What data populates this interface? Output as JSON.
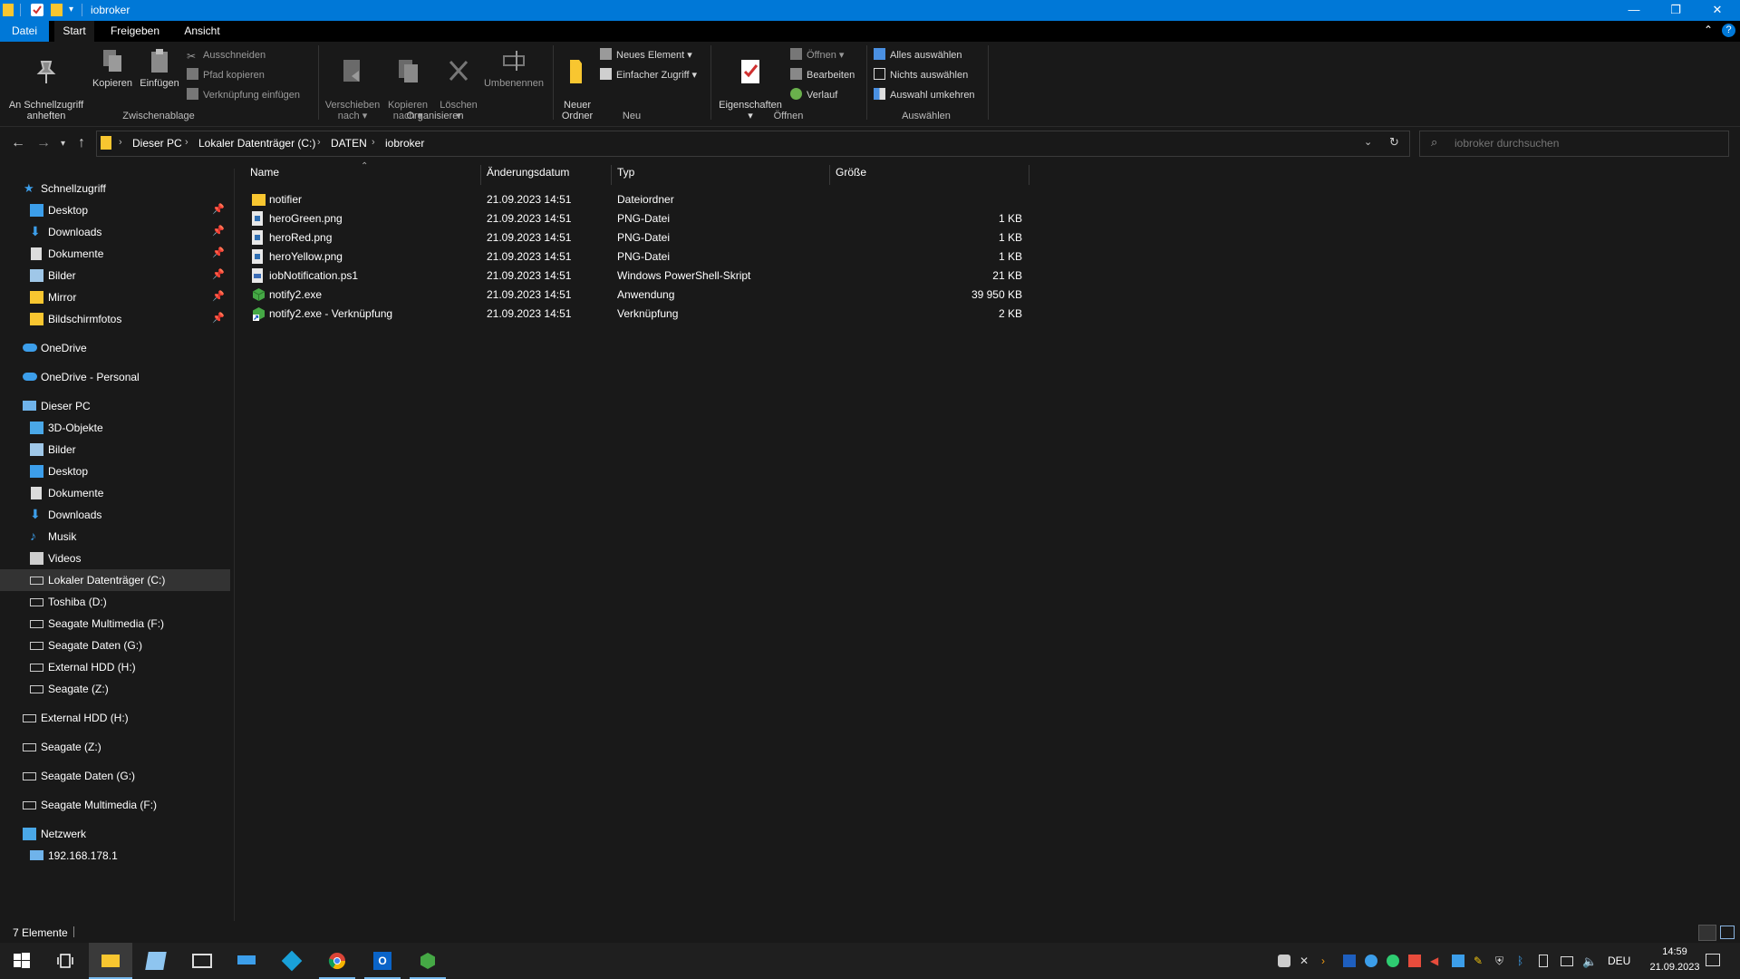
{
  "window": {
    "title": "iobroker",
    "minimize": "—",
    "maximize": "❐",
    "close": "✕"
  },
  "ribbon_tabs": [
    "Datei",
    "Start",
    "Freigeben",
    "Ansicht"
  ],
  "ribbon": {
    "clipboard": {
      "pin": "An Schnellzugriff\nanheften",
      "copy": "Kopieren",
      "paste": "Einfügen",
      "cut": "Ausschneiden",
      "copy_path": "Pfad kopieren",
      "paste_shortcut": "Verknüpfung einfügen",
      "group": "Zwischenablage"
    },
    "organize": {
      "move": "Verschieben\nnach ▾",
      "copyto": "Kopieren\nnach ▾",
      "delete": "Löschen\n▾",
      "rename": "Umbenennen",
      "group": "Organisieren"
    },
    "new": {
      "new_folder": "Neuer\nOrdner",
      "new_item": "Neues Element ▾",
      "easy_access": "Einfacher Zugriff ▾",
      "group": "Neu"
    },
    "open": {
      "properties": "Eigenschaften\n▾",
      "open": "Öffnen ▾",
      "edit": "Bearbeiten",
      "history": "Verlauf",
      "group": "Öffnen"
    },
    "select": {
      "all": "Alles auswählen",
      "none": "Nichts auswählen",
      "invert": "Auswahl umkehren",
      "group": "Auswählen"
    }
  },
  "breadcrumb": [
    "Dieser PC",
    "Lokaler Datenträger (C:)",
    "DATEN",
    "iobroker"
  ],
  "search": {
    "placeholder": "iobroker durchsuchen"
  },
  "nav": {
    "quick_access": "Schnellzugriff",
    "quick_items": [
      "Desktop",
      "Downloads",
      "Dokumente",
      "Bilder",
      "Mirror",
      "Bildschirmfotos"
    ],
    "onedrive": "OneDrive",
    "onedrive_personal": "OneDrive - Personal",
    "this_pc": "Dieser PC",
    "pc_items": [
      "3D-Objekte",
      "Bilder",
      "Desktop",
      "Dokumente",
      "Downloads",
      "Musik",
      "Videos",
      "Lokaler Datenträger (C:)",
      "Toshiba (D:)",
      "Seagate Multimedia (F:)",
      "Seagate Daten (G:)",
      "External HDD (H:)",
      "Seagate (Z:)"
    ],
    "drives": [
      "External HDD (H:)",
      "Seagate (Z:)",
      "Seagate Daten (G:)",
      "Seagate Multimedia (F:)"
    ],
    "network": "Netzwerk",
    "network_items": [
      "192.168.178.1"
    ]
  },
  "columns": [
    "Name",
    "Änderungsdatum",
    "Typ",
    "Größe"
  ],
  "files": [
    {
      "name": "notifier",
      "date": "21.09.2023 14:51",
      "type": "Dateiordner",
      "size": "",
      "icon": "folder-icon"
    },
    {
      "name": "heroGreen.png",
      "date": "21.09.2023 14:51",
      "type": "PNG-Datei",
      "size": "1 KB",
      "icon": "image-file-icon"
    },
    {
      "name": "heroRed.png",
      "date": "21.09.2023 14:51",
      "type": "PNG-Datei",
      "size": "1 KB",
      "icon": "image-file-icon"
    },
    {
      "name": "heroYellow.png",
      "date": "21.09.2023 14:51",
      "type": "PNG-Datei",
      "size": "1 KB",
      "icon": "image-file-icon"
    },
    {
      "name": "iobNotification.ps1",
      "date": "21.09.2023 14:51",
      "type": "Windows PowerShell-Skript",
      "size": "21 KB",
      "icon": "script-file-icon"
    },
    {
      "name": "notify2.exe",
      "date": "21.09.2023 14:51",
      "type": "Anwendung",
      "size": "39 950 KB",
      "icon": "app-cube-icon"
    },
    {
      "name": "notify2.exe - Verknüpfung",
      "date": "21.09.2023 14:51",
      "type": "Verknüpfung",
      "size": "2 KB",
      "icon": "shortcut-icon"
    }
  ],
  "status": {
    "count": "7 Elemente"
  },
  "taskbar": {
    "lang": "DEU",
    "time": "14:59",
    "date": "21.09.2023"
  },
  "colors": {
    "accent": "#0078d7",
    "background": "#191919",
    "folder": "#f8c630"
  }
}
